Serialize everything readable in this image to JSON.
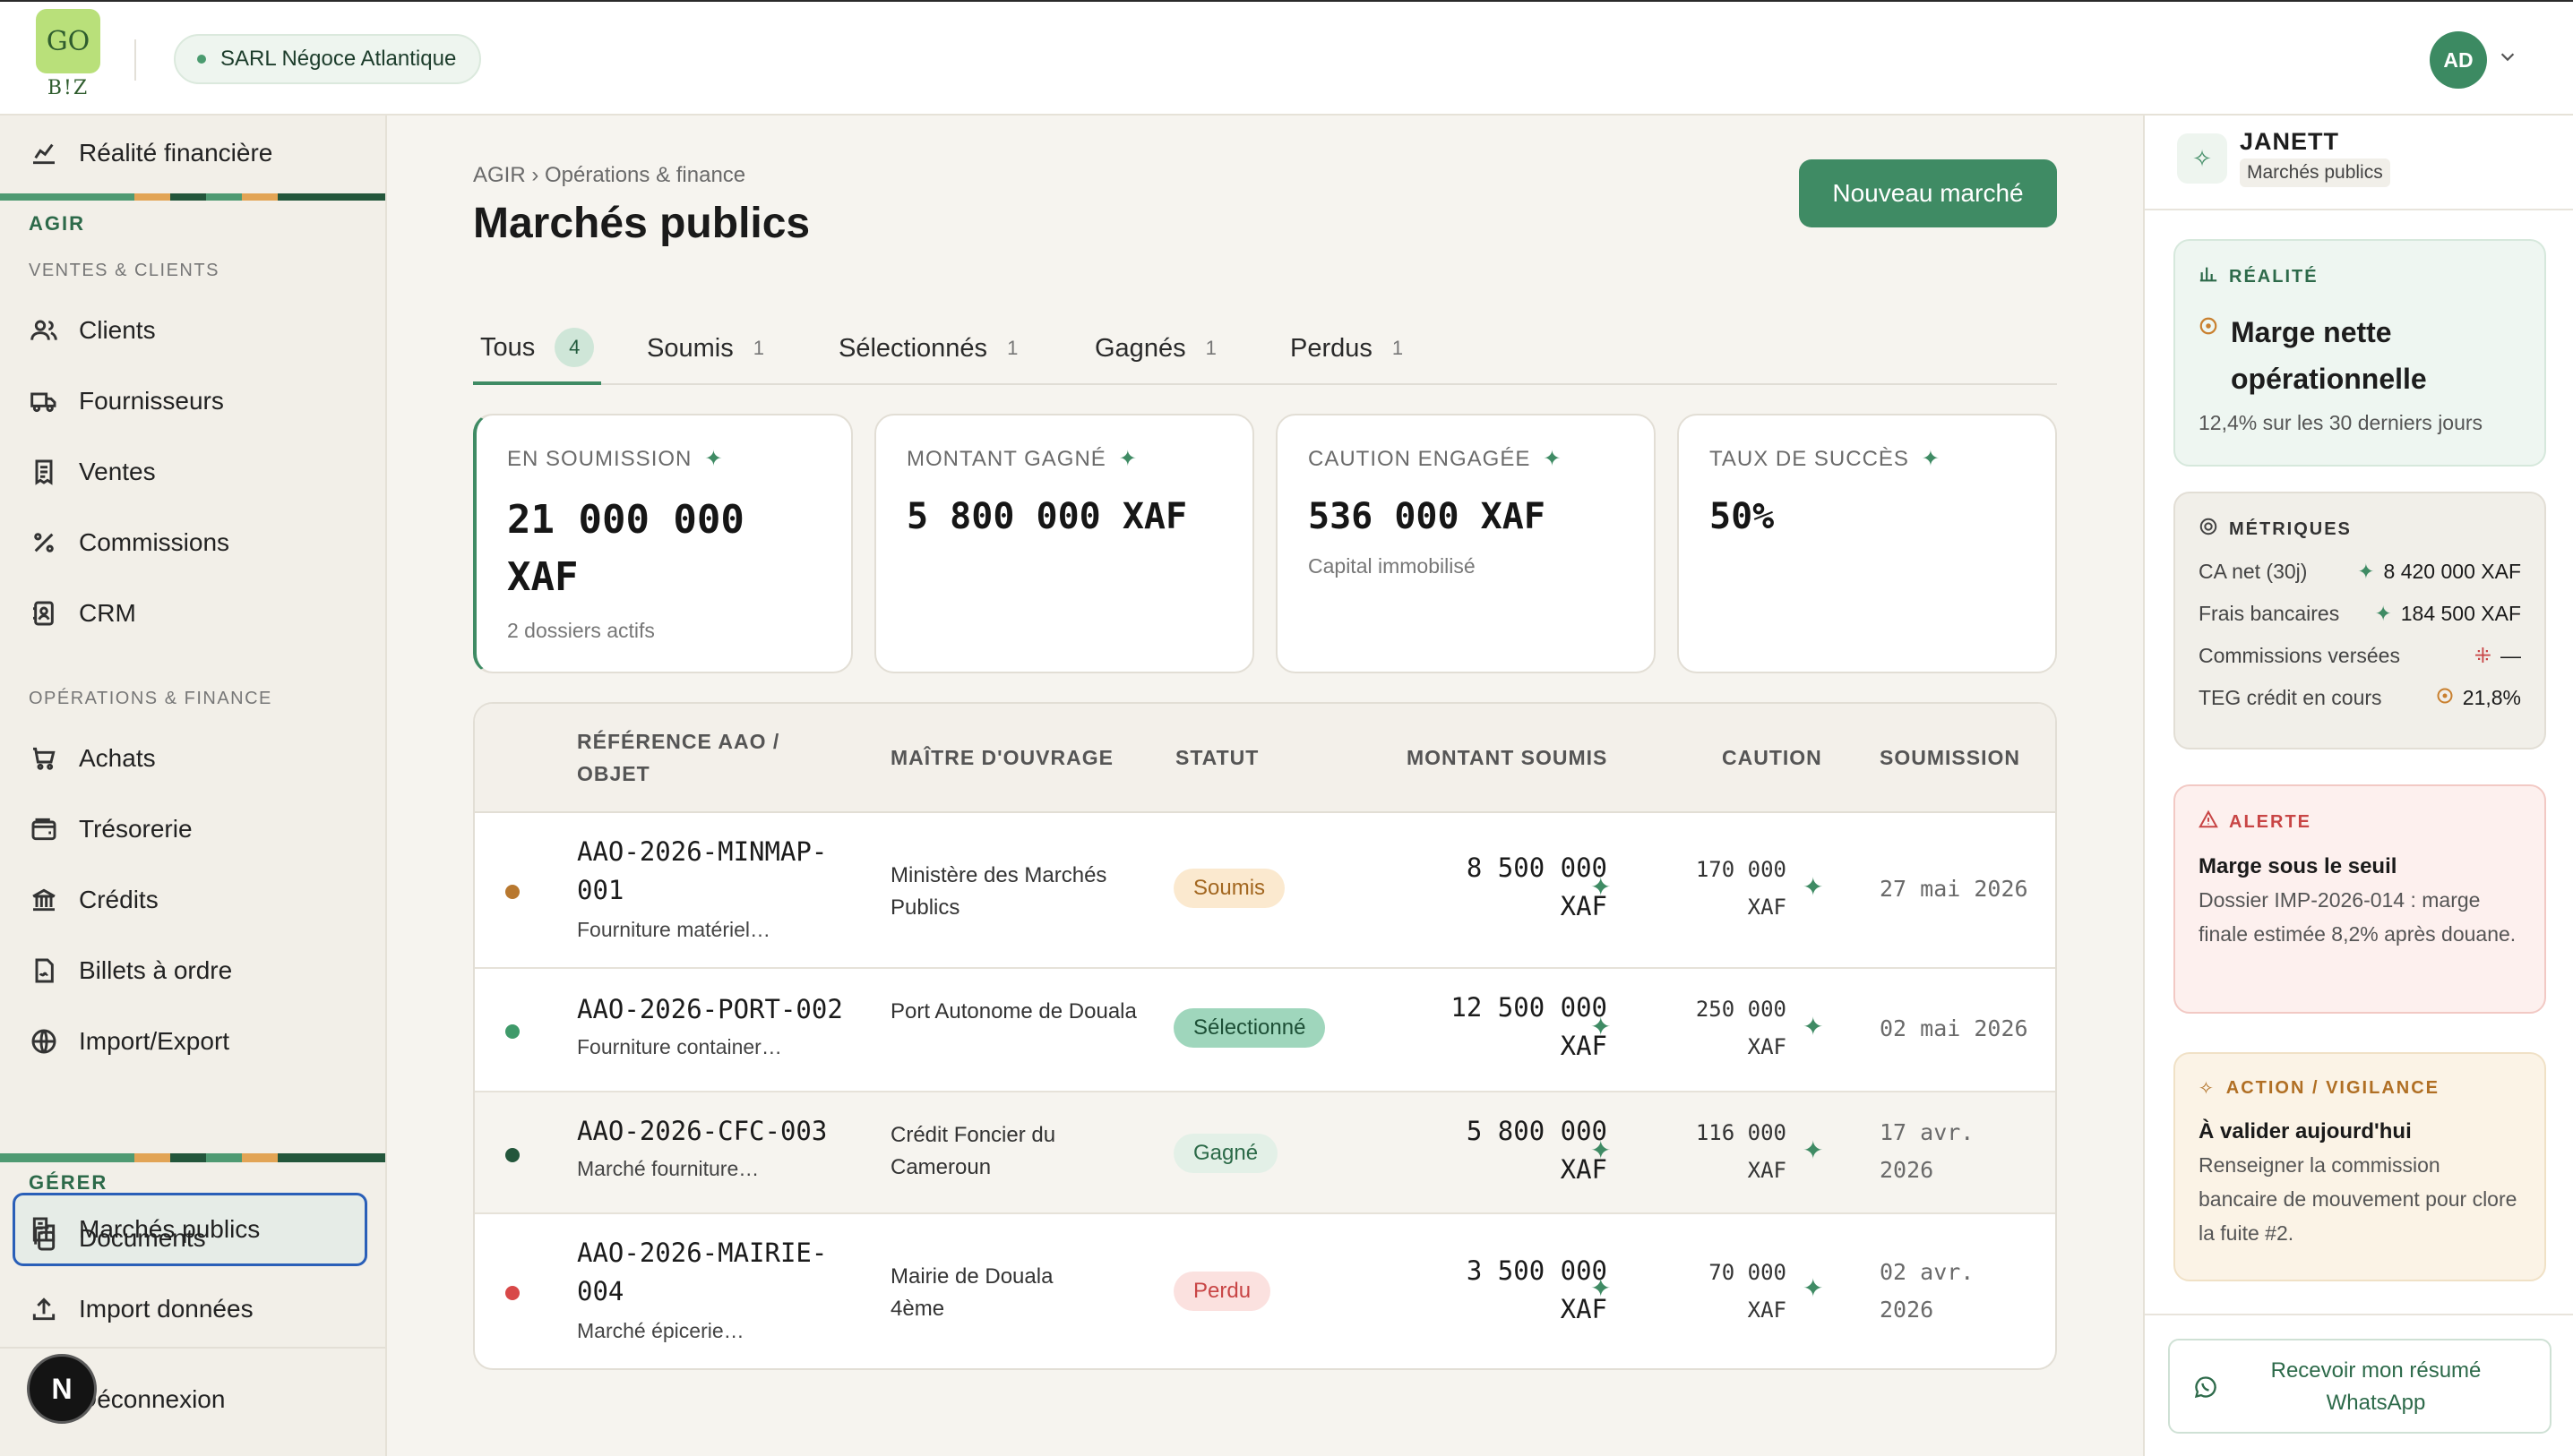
{
  "header": {
    "logo_top": "GO",
    "logo_bottom": "B!Z",
    "company": "SARL Négoce Atlantique",
    "avatar_initials": "AD"
  },
  "sidebar": {
    "top_item": "Réalité financière",
    "section_agir": "AGIR",
    "sub_ventes": "VENTES & CLIENTS",
    "ventes_items": [
      "Clients",
      "Fournisseurs",
      "Ventes",
      "Commissions",
      "CRM"
    ],
    "sub_operations": "OPÉRATIONS & FINANCE",
    "ops_items": [
      "Achats",
      "Trésorerie",
      "Crédits",
      "Billets à ordre",
      "Import/Export",
      "Marchés publics"
    ],
    "section_gerer": "GÉRER",
    "gerer_items": [
      "Documents",
      "Import données"
    ],
    "logout": "Déconnexion",
    "fab_letter": "N"
  },
  "main": {
    "breadcrumb": "AGIR › Opérations & finance",
    "title": "Marchés publics",
    "new_button": "Nouveau marché",
    "tabs": [
      {
        "label": "Tous",
        "count": "4"
      },
      {
        "label": "Soumis",
        "count": "1"
      },
      {
        "label": "Sélectionnés",
        "count": "1"
      },
      {
        "label": "Gagnés",
        "count": "1"
      },
      {
        "label": "Perdus",
        "count": "1"
      }
    ],
    "kpis": [
      {
        "label": "EN SOUMISSION",
        "value": "21 000 000 XAF",
        "note": "2 dossiers actifs"
      },
      {
        "label": "MONTANT GAGNÉ",
        "value": "5 800 000 XAF",
        "note": ""
      },
      {
        "label": "CAUTION ENGAGÉE",
        "value": "536 000 XAF",
        "note": "Capital immobilisé"
      },
      {
        "label": "TAUX DE SUCCÈS",
        "value": "50%",
        "note": ""
      }
    ],
    "table": {
      "headers": [
        "RÉFÉRENCE AAO / OBJET",
        "MAÎTRE D'OUVRAGE",
        "STATUT",
        "MONTANT SOUMIS",
        "CAUTION",
        "SOUMISSION"
      ],
      "rows": [
        {
          "ref": "AAO-2026-MINMAP-001",
          "obj": "Fourniture matériel…",
          "owner": "Ministère des Marchés Publics",
          "status": "Soumis",
          "amount": "8 500 000 XAF",
          "caution": "170 000 XAF",
          "date": "27 mai 2026",
          "dot": "#b8782f"
        },
        {
          "ref": "AAO-2026-PORT-002",
          "obj": "Fourniture container…",
          "owner": "Port Autonome de Douala",
          "status": "Sélectionné",
          "amount": "12 500 000 XAF",
          "caution": "250 000 XAF",
          "date": "02 mai 2026",
          "dot": "#3f9a6a"
        },
        {
          "ref": "AAO-2026-CFC-003",
          "obj": "Marché fourniture…",
          "owner": "Crédit Foncier du Cameroun",
          "status": "Gagné",
          "amount": "5 800 000 XAF",
          "caution": "116 000 XAF",
          "date": "17 avr. 2026",
          "dot": "#23563b"
        },
        {
          "ref": "AAO-2026-MAIRIE-004",
          "obj": "Marché épicerie…",
          "owner": "Mairie de Douala 4ème",
          "status": "Perdu",
          "amount": "3 500 000 XAF",
          "caution": "70 000 XAF",
          "date": "02 avr. 2026",
          "dot": "#d84848"
        }
      ]
    }
  },
  "janett": {
    "name": "JANETT",
    "context": "Marchés publics",
    "reality": {
      "title": "RÉALITÉ",
      "headline": "Marge nette opérationnelle",
      "text": "12,4% sur les 30 derniers jours"
    },
    "metrics": {
      "title": "MÉTRIQUES",
      "rows": [
        {
          "label": "CA net (30j)",
          "value": "8 420 000 XAF"
        },
        {
          "label": "Frais bancaires",
          "value": "184 500 XAF"
        },
        {
          "label": "Commissions versées",
          "value": "—"
        },
        {
          "label": "TEG crédit en cours",
          "value": "21,8%"
        }
      ]
    },
    "alert": {
      "title": "ALERTE",
      "headline": "Marge sous le seuil",
      "text": "Dossier IMP-2026-014 : marge finale estimée 8,2% après douane."
    },
    "action": {
      "title": "ACTION / VIGILANCE",
      "headline": "À valider aujourd'hui",
      "text": "Renseigner la commission bancaire de mouvement pour clore la fuite #2."
    },
    "whatsapp": "Recevoir mon résumé WhatsApp"
  },
  "colors": {
    "accent": "#3f8b64",
    "soumis_bg": "#fbe9cf",
    "soumis_fg": "#a2661f",
    "selected_bg": "#9fd6bc",
    "selected_fg": "#1d4f36",
    "won_bg": "#e3f0e7",
    "won_fg": "#2c6a48",
    "lost_bg": "#fbe1df",
    "lost_fg": "#c84545"
  }
}
